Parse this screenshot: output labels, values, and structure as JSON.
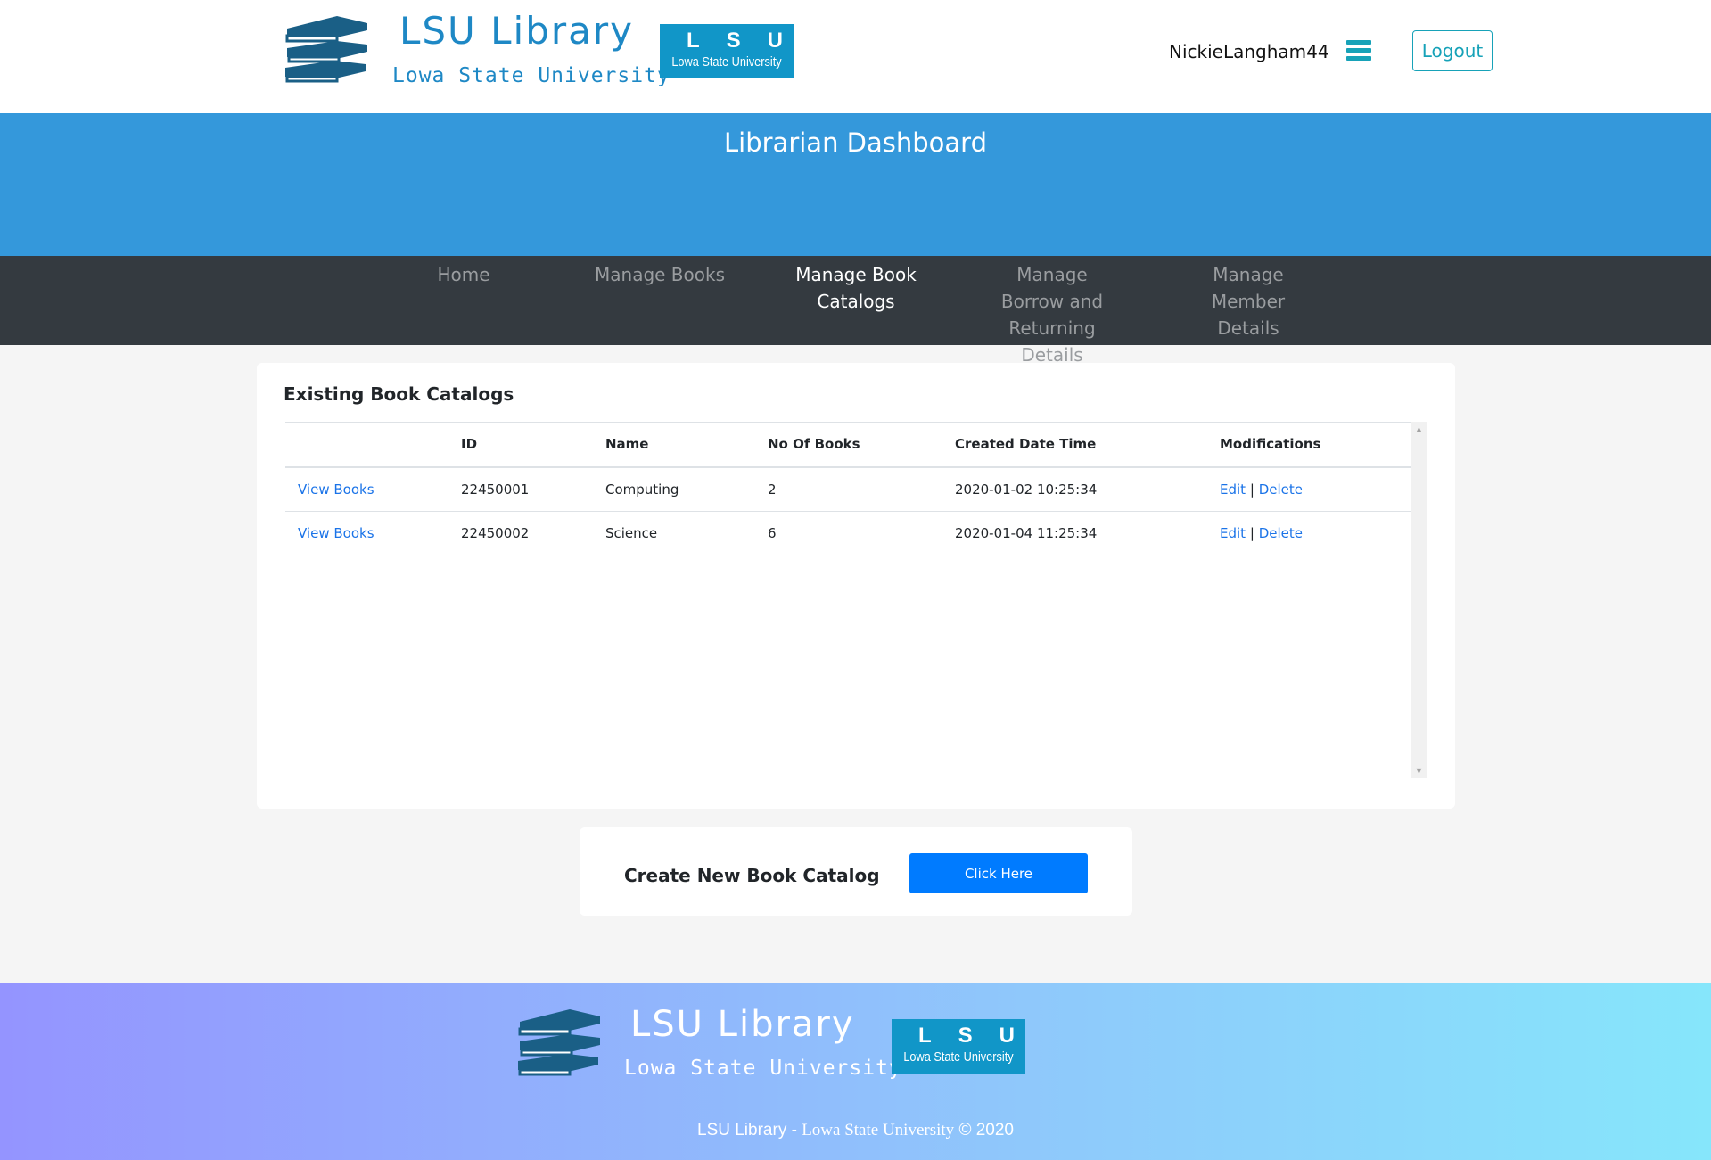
{
  "header": {
    "brand_title": "LSU Library",
    "brand_subtitle": "Lowa State University",
    "badge_letters": "LSU",
    "badge_text": "Lowa State University",
    "username": "NickieLangham44",
    "logout_label": "Logout",
    "menu_icon": "hamburger-menu-icon",
    "accent_color": "#17a2b8",
    "brand_color": "#1e88c5"
  },
  "banner": {
    "title": "Librarian Dashboard",
    "color": "#3498db"
  },
  "nav": {
    "items": [
      {
        "label": "Home",
        "active": false
      },
      {
        "label": "Manage Books",
        "active": false
      },
      {
        "label": "Manage Book Catalogs",
        "active": true
      },
      {
        "label": "Manage Borrow and Returning Details",
        "active": false
      },
      {
        "label": "Manage Member Details",
        "active": false
      }
    ]
  },
  "catalogs": {
    "title": "Existing Book Catalogs",
    "columns": [
      "",
      "ID",
      "Name",
      "No Of Books",
      "Created Date Time",
      "Modifications"
    ],
    "rows": [
      {
        "action": "View Books",
        "id": "22450001",
        "name": "Computing",
        "count": "2",
        "created": "2020-01-02 10:25:34",
        "edit": "Edit",
        "sep": "|",
        "delete": "Delete"
      },
      {
        "action": "View Books",
        "id": "22450002",
        "name": "Science",
        "count": "6",
        "created": "2020-01-04 11:25:34",
        "edit": "Edit",
        "sep": "|",
        "delete": "Delete"
      }
    ]
  },
  "create": {
    "label": "Create New Book Catalog",
    "button_label": "Click Here",
    "button_color": "#007bff"
  },
  "footer": {
    "brand_title": "LSU Library",
    "brand_subtitle": "Lowa State University",
    "copyright_a": "LSU Library - ",
    "copyright_b": "Lowa State University",
    "copyright_c": " © 2020"
  }
}
